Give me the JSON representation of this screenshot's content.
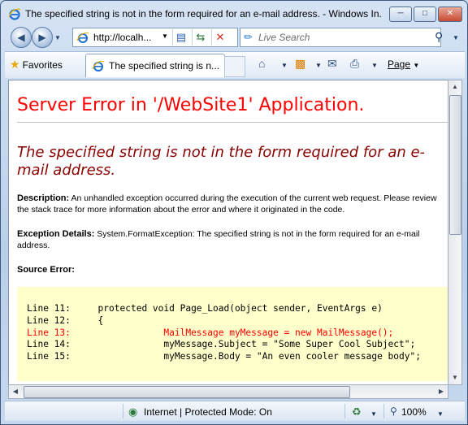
{
  "window": {
    "title": "The specified string is not in the form required for an e-mail address. - Windows In...",
    "buttons": {
      "minimize": "─",
      "maximize": "□",
      "close": "✕"
    }
  },
  "address": {
    "url": "http://localh...",
    "search_placeholder": "Live Search"
  },
  "command": {
    "favorites_label": "Favorites",
    "tab_title": "The specified string is n...",
    "page_label": "Page"
  },
  "page": {
    "error_title": "Server Error in '/WebSite1' Application.",
    "message": "The specified string is not in the form required for an e-mail address.",
    "description_label": "Description:",
    "description_text": "An unhandled exception occurred during the execution of the current web request. Please review the stack trace for more information about the error and where it originated in the code.",
    "exception_label": "Exception Details:",
    "exception_text": "System.FormatException: The specified string is not in the form required for an e-mail address.",
    "source_label": "Source Error:",
    "code_lines": [
      "Line 11:     protected void Page_Load(object sender, EventArgs e)",
      "Line 12:     {",
      "Line 13:                 MailMessage myMessage = new MailMessage();",
      "Line 14:                 myMessage.Subject = \"Some Super Cool Subject\";",
      "Line 15:                 myMessage.Body = \"An even cooler message body\";"
    ]
  },
  "status": {
    "zone": "Internet | Protected Mode: On",
    "zoom": "100%"
  },
  "colors": {
    "error_red": "#ff0000",
    "message_darkred": "#8b0000",
    "source_bg": "#ffffcc"
  }
}
